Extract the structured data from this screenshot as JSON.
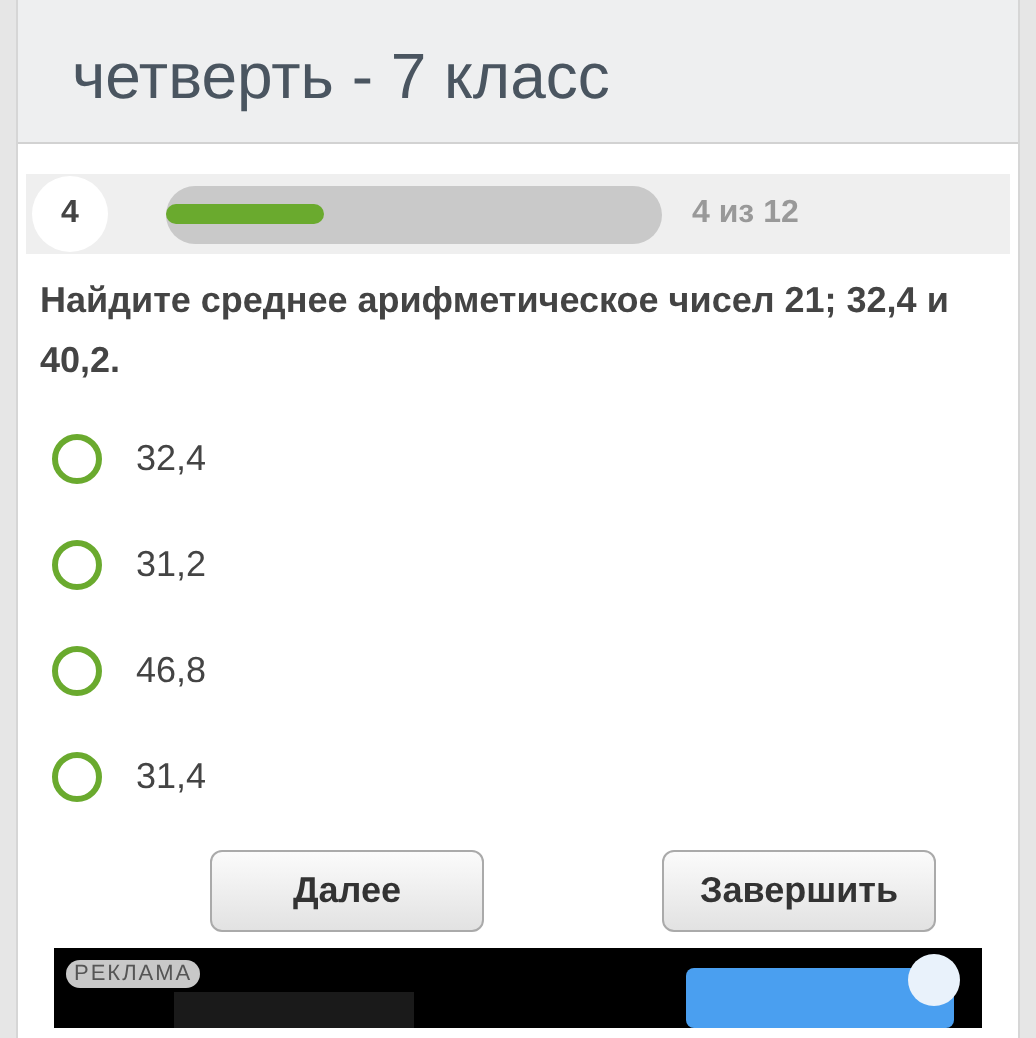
{
  "title": "четверть - 7 класс",
  "progress": {
    "number": "4",
    "level": 0.32,
    "reading": "4 из 12"
  },
  "question": "Найдите среднее арифметическое чисел 21; 32,4 и 40,2.",
  "options": [
    {
      "label": "32,4",
      "selected": false
    },
    {
      "label": "31,2",
      "selected": false
    },
    {
      "label": "46,8",
      "selected": false
    },
    {
      "label": "31,4",
      "selected": false
    }
  ],
  "buttons": [
    "Далее",
    "Завершить"
  ],
  "ad": {
    "label": "РЕКЛАМА",
    "kind": "picture"
  }
}
